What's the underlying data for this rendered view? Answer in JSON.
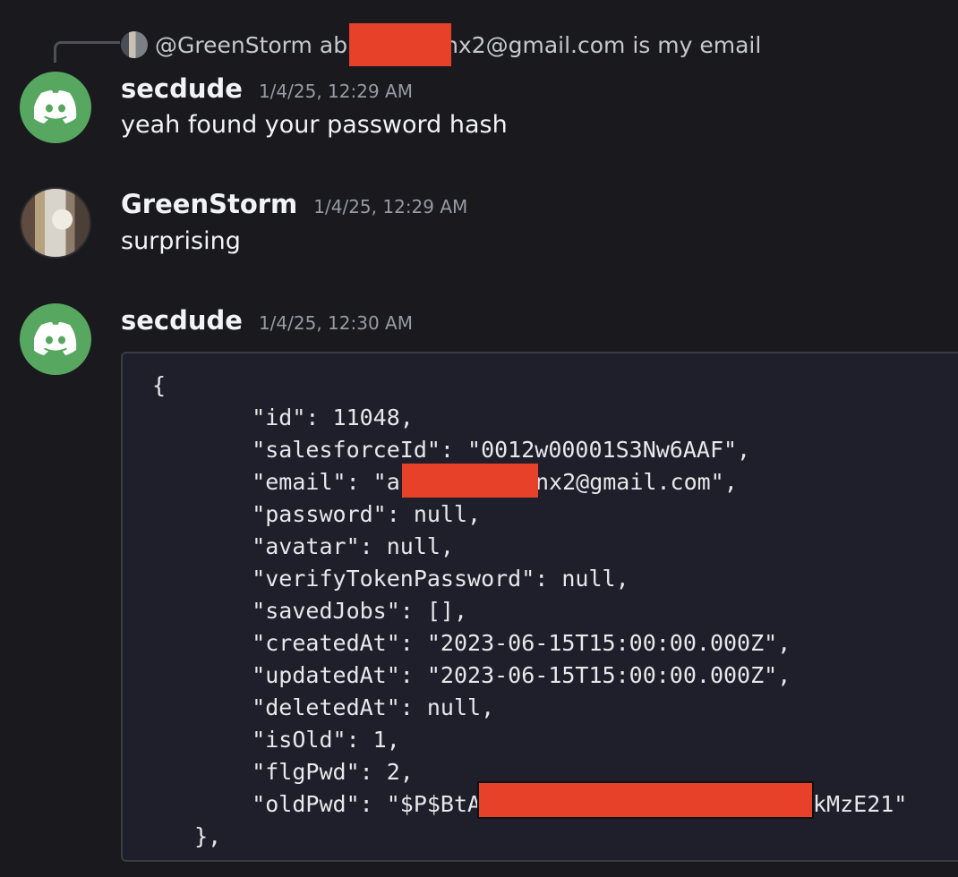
{
  "reply": {
    "username": "@GreenStorm",
    "text_prefix": "ab",
    "text_suffix": "nx2@gmail.com is my email"
  },
  "messages": [
    {
      "username": "secdude",
      "timestamp": "1/4/25, 12:29 AM",
      "text": "yeah found your password hash",
      "avatar_icon": "discord-logo-icon"
    },
    {
      "username": "GreenStorm",
      "timestamp": "1/4/25, 12:29 AM",
      "text": "surprising",
      "avatar_icon": "cat-photo-avatar"
    },
    {
      "username": "secdude",
      "timestamp": "1/4/25, 12:30 AM",
      "avatar_icon": "discord-logo-icon",
      "code_lines": [
        "{",
        "    \"id\": 11048,",
        "    \"salesforceId\": \"0012w00001S3Nw6AAF\",",
        "    \"email\": \"ab",
        "    \"password\": null,",
        "    \"avatar\": null,",
        "    \"verifyTokenPassword\": null,",
        "    \"savedJobs\": [],",
        "    \"createdAt\": \"2023-06-15T15:00:00.000Z\",",
        "    \"updatedAt\": \"2023-06-15T15:00:00.000Z\",",
        "    \"deletedAt\": null,",
        "    \"isOld\": 1,",
        "    \"flgPwd\": 2,",
        "    \"oldPwd\": \"$P$BtA",
        "  },"
      ],
      "email_suffix": "nx2@gmail.com\",",
      "oldpwd_suffix": "kMzE21\""
    }
  ],
  "colors": {
    "background": "#1a1a1e",
    "discord_green": "#57a760",
    "redaction": "#e8412a",
    "timestamp": "#949ba4"
  }
}
